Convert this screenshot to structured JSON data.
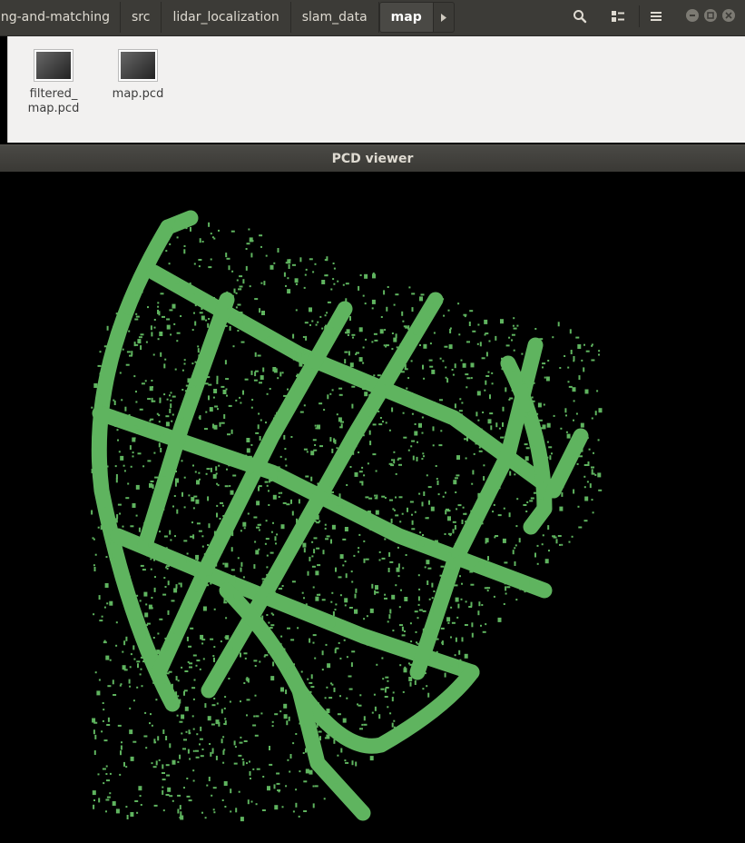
{
  "breadcrumbs": [
    {
      "label": "ping-and-matching"
    },
    {
      "label": "src"
    },
    {
      "label": "lidar_localization"
    },
    {
      "label": "slam_data"
    },
    {
      "label": "map"
    }
  ],
  "header_icons": [
    "search-icon",
    "view-options-icon",
    "menu-icon",
    "minimize-icon",
    "maximize-icon",
    "close-icon"
  ],
  "files": [
    {
      "name": "filtered_\nmap.pcd"
    },
    {
      "name": "map.pcd"
    }
  ],
  "viewer": {
    "title": "PCD viewer",
    "point_color": "#5fb45f",
    "background": "#000000"
  }
}
